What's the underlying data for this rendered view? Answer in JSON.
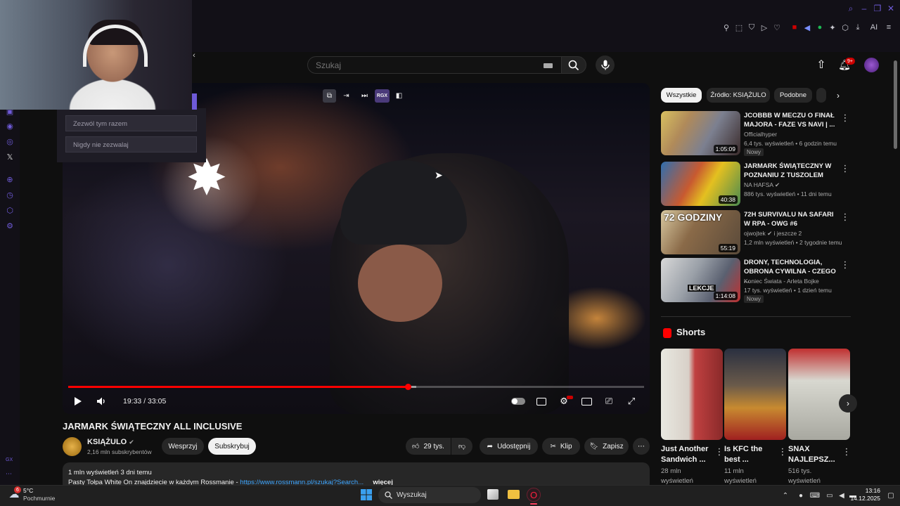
{
  "browser": {
    "window_controls": [
      "search-icon",
      "minimize-icon",
      "restore-icon",
      "close-icon"
    ],
    "extensions": [
      "pin-icon",
      "screenshot-icon",
      "shield-icon",
      "play-icon",
      "heart-icon",
      "flag-icon",
      "volume-icon",
      "extension-icon",
      "puzzle-icon",
      "download-icon"
    ],
    "ai_label": "AI",
    "sidebar_icons": [
      "twitch-icon",
      "messenger-icon",
      "instagram-icon",
      "x-icon",
      "add-icon",
      "history-icon",
      "extensions-icon",
      "settings-icon"
    ],
    "sidebar_footer": "GX"
  },
  "youtube_header": {
    "search_placeholder": "Szukaj",
    "notifications_badge": "9+"
  },
  "overlay": {
    "option_allow_once": "Zezwól tym razem",
    "option_never": "Nigdy nie zezwalaj",
    "video_tools_label": "RGX"
  },
  "player": {
    "time_current": "19:33",
    "time_total": "33:05",
    "time_display": "19:33 / 33:05",
    "progress": 0.59,
    "buffered": 0.605
  },
  "video": {
    "title": "JARMARK ŚWIĄTECZNY ALL INCLUSIVE",
    "channel": "KSIĄŻULO",
    "subscribers": "2,16 mln subskrybentów",
    "support_label": "Wesprzyj",
    "subscribe_label": "Subskrybuj",
    "likes": "29 tys.",
    "share_label": "Udostępnij",
    "clip_label": "Klip",
    "save_label": "Zapisz",
    "description_stats": "1 mln wyświetleń  3 dni temu",
    "description_text": "Pasty Tołpa White On znajdziecie w każdym Rossmanie - ",
    "description_link": "https://www.rossmann.pl/szukaj?Search...",
    "description_more": "więcej"
  },
  "filters": [
    "Wszystkie",
    "Źródło: KSIĄŻULO",
    "Podobne"
  ],
  "recommendations": [
    {
      "title": "JCOBBB W MECZU O FINAŁ MAJORA - FaZe vs NaVi | ...",
      "channel": "Officialhyper",
      "stats": "6,4 tys. wyświetleń • 6 godzin temu",
      "duration": "1:05:09",
      "badge": "Nowy"
    },
    {
      "title": "JARMARK ŚWIĄTECZNY W POZNANIU Z TUSZOLEM",
      "channel": "NA HAFSA",
      "stats": "886 tys. wyświetleń • 11 dni temu",
      "duration": "40:38",
      "badge": ""
    },
    {
      "title": "72H SURVIVALU NA SAFARI W RPA - owg #6",
      "channel": "ojwojtek",
      "channel_extra": "i jeszcze 2",
      "stats": "1,2 mln wyświetleń • 2 tygodnie temu",
      "duration": "55:19",
      "badge": "",
      "thumb_text": "72 GODZINY"
    },
    {
      "title": "DRONY, TECHNOLOGIA, OBRONA CYWILNA - CZEGO ...",
      "channel": "Koniec Świata - Arleta Bojke",
      "stats": "17 tys. wyświetleń • 1 dzień temu",
      "duration": "1:14:08",
      "badge": "Nowy",
      "thumb_text": "LEKCJE"
    }
  ],
  "shorts": {
    "heading": "Shorts",
    "items": [
      {
        "title": "Just Another Sandwich ...",
        "views": "28 mln wyświetleń"
      },
      {
        "title": "Is KFC the best ...",
        "views": "11 mln wyświetleń"
      },
      {
        "title": "SNAX NAJLEPSZ...",
        "views": "516 tys. wyświetleń"
      }
    ]
  },
  "taskbar": {
    "weather_temp": "5°C",
    "weather_desc": "Pochmurnie",
    "weather_badge": "6",
    "search_label": "Wyszukaj",
    "time": "13:16",
    "date": "14.12.2025"
  },
  "colors": {
    "accent_purple": "#6e5ad8",
    "youtube_red": "#ff0000",
    "background": "#0f0f0f",
    "link_blue": "#3ea6ff"
  }
}
